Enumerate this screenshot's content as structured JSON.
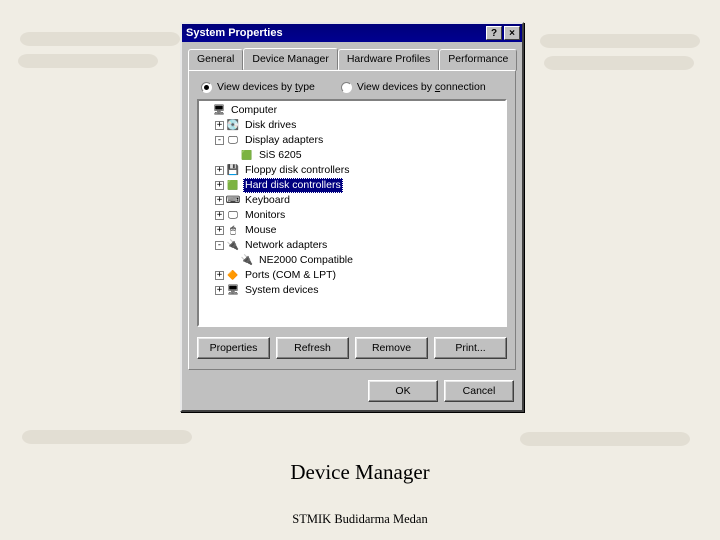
{
  "window": {
    "title": "System Properties",
    "help": "?",
    "close": "×"
  },
  "tabs": {
    "general": "General",
    "device_manager": "Device Manager",
    "hardware_profiles": "Hardware Profiles",
    "performance": "Performance"
  },
  "radios": {
    "by_type_pre": "View devices by ",
    "by_type_u": "t",
    "by_type_post": "ype",
    "by_conn_pre": "View devices by ",
    "by_conn_u": "c",
    "by_conn_post": "onnection"
  },
  "tree": {
    "root": "Computer",
    "items": [
      {
        "label": "Disk drives",
        "icon": "ic-disk",
        "exp": "+"
      },
      {
        "label": "Display adapters",
        "icon": "ic-mon",
        "exp": "-",
        "children": [
          {
            "label": "SiS 6205",
            "icon": "ic-card"
          }
        ]
      },
      {
        "label": "Floppy disk controllers",
        "icon": "ic-flop",
        "exp": "+"
      },
      {
        "label": "Hard disk controllers",
        "icon": "ic-card",
        "exp": "+",
        "selected": true
      },
      {
        "label": "Keyboard",
        "icon": "ic-kbd",
        "exp": "+"
      },
      {
        "label": "Monitors",
        "icon": "ic-mon",
        "exp": "+"
      },
      {
        "label": "Mouse",
        "icon": "ic-mouse",
        "exp": "+"
      },
      {
        "label": "Network adapters",
        "icon": "ic-net",
        "exp": "-",
        "children": [
          {
            "label": "NE2000 Compatible",
            "icon": "ic-net"
          }
        ]
      },
      {
        "label": "Ports (COM & LPT)",
        "icon": "ic-port",
        "exp": "+"
      },
      {
        "label": "System devices",
        "icon": "ic-sys",
        "exp": "+"
      }
    ]
  },
  "buttons": {
    "properties": "Properties",
    "refresh": "Refresh",
    "remove": "Remove",
    "print": "Print..."
  },
  "footer": {
    "ok": "OK",
    "cancel": "Cancel"
  },
  "caption": "Device Manager",
  "subcaption": "STMIK Budidarma Medan"
}
